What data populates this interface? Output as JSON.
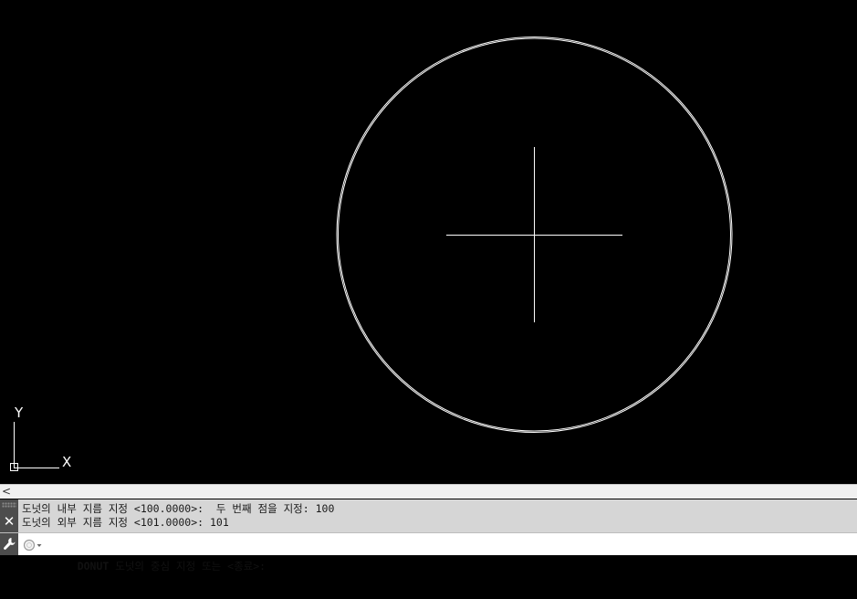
{
  "ucs": {
    "y_label": "Y",
    "x_label": "X"
  },
  "scroll": {
    "left_arrow": "<"
  },
  "history": {
    "close_symbol": "✕",
    "lines": [
      "도넛의 내부 지름 지정 <100.0000>:  두 번째 점을 지정: 100",
      "도넛의 외부 지름 지정 <101.0000>: 101"
    ]
  },
  "command_line": {
    "command": "DONUT",
    "prompt": " 도넛의 중심 지정 또는 <종료>:",
    "input_value": ""
  },
  "colors": {
    "canvas": "#000000",
    "geometry": "#ffffff",
    "history_bg": "#d6d6d6"
  }
}
